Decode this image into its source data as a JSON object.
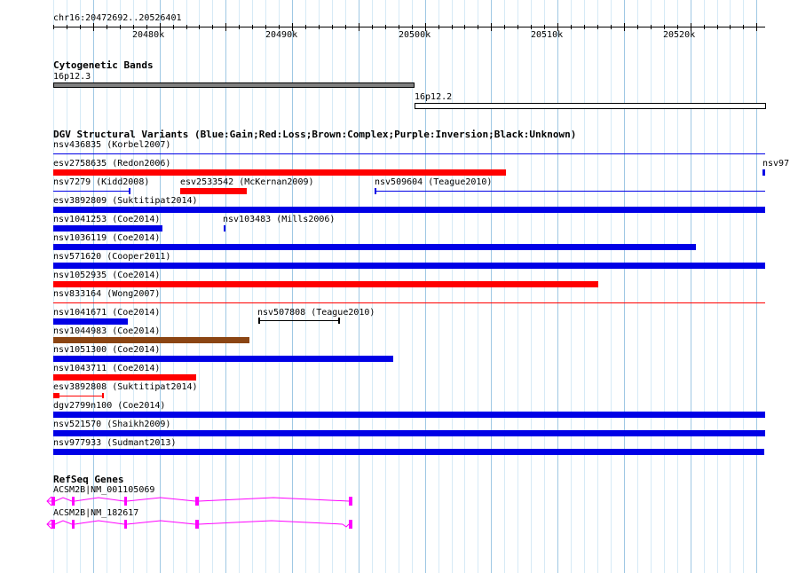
{
  "region": "chr16:20472692..20526401",
  "ruler": {
    "labels": [
      "20480k",
      "20490k",
      "20500k",
      "20510k",
      "20520k"
    ]
  },
  "cytobands": {
    "title": "Cytogenetic Bands",
    "bands": [
      {
        "label": "16p12.3",
        "fill": "#808080"
      },
      {
        "label": "16p12.2",
        "fill": "#ffffff"
      }
    ]
  },
  "dgv": {
    "title": "DGV Structural Variants (Blue:Gain;Red:Loss;Brown:Complex;Purple:Inversion;Black:Unknown)",
    "colors": {
      "gain": "#0000e6",
      "loss": "#ff0000",
      "complex": "#8b4513",
      "other": "#000000"
    },
    "variants": [
      {
        "label": "nsv436835 (Korbel2007)",
        "type": "gain"
      },
      {
        "label": "esv2758635 (Redon2006)",
        "type": "loss"
      },
      {
        "label": "nsv97",
        "type": "gain"
      },
      {
        "label": "nsv7279 (Kidd2008)",
        "type": "gain"
      },
      {
        "label": "esv2533542 (McKernan2009)",
        "type": "loss"
      },
      {
        "label": "nsv509604 (Teague2010)",
        "type": "gain"
      },
      {
        "label": "esv3892809 (Suktitipat2014)",
        "type": "gain"
      },
      {
        "label": "nsv1041253 (Coe2014)",
        "type": "gain"
      },
      {
        "label": "nsv103483 (Mills2006)",
        "type": "gain"
      },
      {
        "label": "nsv1036119 (Coe2014)",
        "type": "gain"
      },
      {
        "label": "nsv571620 (Cooper2011)",
        "type": "gain"
      },
      {
        "label": "nsv1052935 (Coe2014)",
        "type": "loss"
      },
      {
        "label": "nsv833164 (Wong2007)",
        "type": "loss"
      },
      {
        "label": "nsv1041671 (Coe2014)",
        "type": "gain"
      },
      {
        "label": "nsv507808 (Teague2010)",
        "type": "other"
      },
      {
        "label": "nsv1044983 (Coe2014)",
        "type": "complex"
      },
      {
        "label": "nsv1051300 (Coe2014)",
        "type": "gain"
      },
      {
        "label": "nsv1043711 (Coe2014)",
        "type": "loss"
      },
      {
        "label": "esv3892808 (Suktitipat2014)",
        "type": "loss"
      },
      {
        "label": "dgv2799n100 (Coe2014)",
        "type": "gain"
      },
      {
        "label": "nsv521570 (Shaikh2009)",
        "type": "gain"
      },
      {
        "label": "nsv977933 (Sudmant2013)",
        "type": "gain"
      }
    ]
  },
  "refseq": {
    "title": "RefSeq Genes",
    "color": "#ff00ff",
    "genes": [
      {
        "label": "ACSM2B|NM_001105069"
      },
      {
        "label": "ACSM2B|NM_182617"
      }
    ]
  }
}
